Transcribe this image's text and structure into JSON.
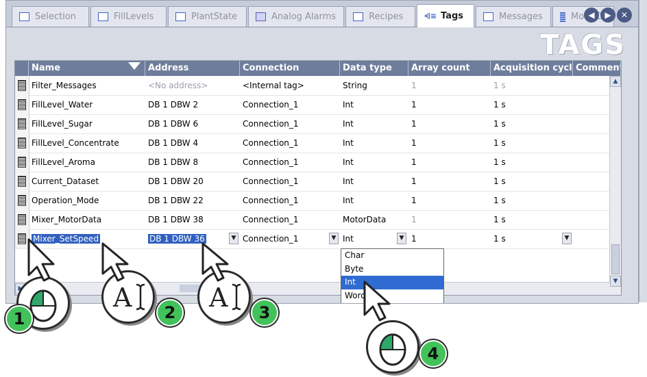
{
  "tabs": [
    {
      "label": "Selection"
    },
    {
      "label": "FillLevels"
    },
    {
      "label": "PlantState"
    },
    {
      "label": "Analog Alarms"
    },
    {
      "label": "Recipes"
    },
    {
      "label": "Tags"
    },
    {
      "label": "Messages"
    },
    {
      "label": "MotorDat"
    }
  ],
  "editor_title": "TAGS",
  "columns": [
    "Name",
    "Address",
    "Connection",
    "Data type",
    "Array count",
    "Acquisition cycle",
    "Comment"
  ],
  "rows": [
    {
      "name": "Filter_Messages",
      "address": "<No address>",
      "connection": "<Internal tag>",
      "datatype": "String",
      "array": "1",
      "cycle": "1 s"
    },
    {
      "name": "FillLevel_Water",
      "address": "DB 1 DBW 2",
      "connection": "Connection_1",
      "datatype": "Int",
      "array": "1",
      "cycle": "1 s"
    },
    {
      "name": "FillLevel_Sugar",
      "address": "DB 1 DBW 6",
      "connection": "Connection_1",
      "datatype": "Int",
      "array": "1",
      "cycle": "1 s"
    },
    {
      "name": "FillLevel_Concentrate",
      "address": "DB 1 DBW 4",
      "connection": "Connection_1",
      "datatype": "Int",
      "array": "1",
      "cycle": "1 s"
    },
    {
      "name": "FillLevel_Aroma",
      "address": "DB 1 DBW 8",
      "connection": "Connection_1",
      "datatype": "Int",
      "array": "1",
      "cycle": "1 s"
    },
    {
      "name": "Current_Dataset",
      "address": "DB 1 DBW 20",
      "connection": "Connection_1",
      "datatype": "Int",
      "array": "1",
      "cycle": "1 s"
    },
    {
      "name": "Operation_Mode",
      "address": "DB 1 DBW 22",
      "connection": "Connection_1",
      "datatype": "Int",
      "array": "1",
      "cycle": "1 s"
    },
    {
      "name": "Mixer_MotorData",
      "address": "DB 1 DBW 38",
      "connection": "Connection_1",
      "datatype": "MotorData",
      "array": "1",
      "cycle": "1 s"
    }
  ],
  "edit_row": {
    "name": "Mixer_SetSpeed",
    "address": "DB 1 DBW 36",
    "connection": "Connection_1",
    "datatype": "Int",
    "array": "1",
    "cycle": "1 s"
  },
  "datatype_options": [
    "Char",
    "Byte",
    "Int",
    "Word"
  ],
  "datatype_selected": "Int",
  "steps": [
    "1",
    "2",
    "3",
    "4"
  ],
  "colors": {
    "header": "#6f7d9c",
    "selection": "#2f6bd0",
    "badge": "#41c25a"
  }
}
